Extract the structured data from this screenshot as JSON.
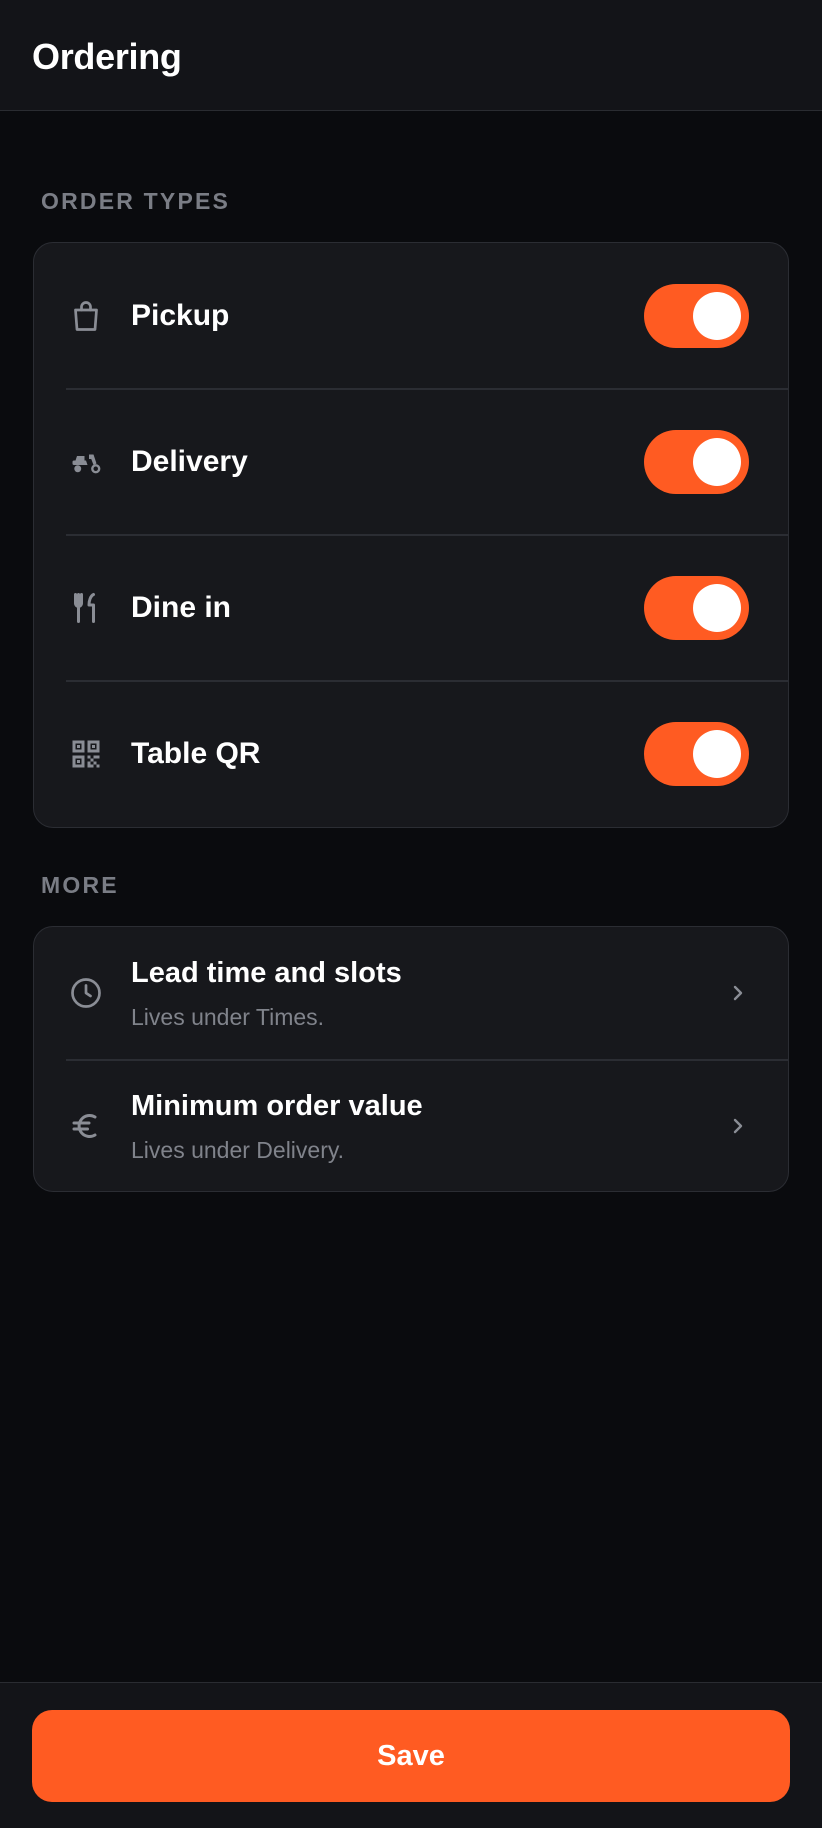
{
  "header": {
    "title": "Ordering"
  },
  "sections": {
    "order_types": {
      "label": "ORDER TYPES",
      "items": [
        {
          "icon": "shopping-bag-icon",
          "label": "Pickup",
          "enabled": true
        },
        {
          "icon": "scooter-icon",
          "label": "Delivery",
          "enabled": true
        },
        {
          "icon": "utensils-icon",
          "label": "Dine in",
          "enabled": true
        },
        {
          "icon": "qr-code-icon",
          "label": "Table QR",
          "enabled": true
        }
      ]
    },
    "more": {
      "label": "MORE",
      "items": [
        {
          "icon": "clock-icon",
          "label": "Lead time and slots",
          "sublabel": "Lives under Times."
        },
        {
          "icon": "euro-icon",
          "label": "Minimum order value",
          "sublabel": "Lives under Delivery."
        }
      ]
    }
  },
  "footer": {
    "save_label": "Save"
  },
  "colors": {
    "accent": "#ff5b22",
    "background": "#0a0b0e",
    "card": "#17181c",
    "muted_text": "#7a7d85"
  }
}
